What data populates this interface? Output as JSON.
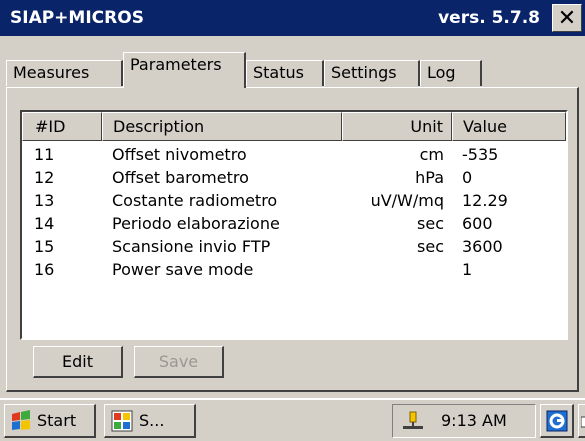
{
  "window": {
    "title": "SIAP+MICROS",
    "version": "vers. 5.7.8",
    "close_label": "✕"
  },
  "tabs": [
    {
      "label": "Measures",
      "active": false
    },
    {
      "label": "Parameters",
      "active": true
    },
    {
      "label": "Status",
      "active": false
    },
    {
      "label": "Settings",
      "active": false
    },
    {
      "label": "Log",
      "active": false
    }
  ],
  "table": {
    "columns": [
      "#ID",
      "Description",
      "Unit",
      "Value"
    ],
    "rows": [
      [
        "11",
        "Offset nivometro",
        "cm",
        "-535"
      ],
      [
        "12",
        "Offset barometro",
        "hPa",
        "0"
      ],
      [
        "13",
        "Costante radiometro",
        "uV/W/mq",
        "12.29"
      ],
      [
        "14",
        "Periodo elaborazione",
        "sec",
        "600"
      ],
      [
        "15",
        "Scansione invio FTP",
        "sec",
        "3600"
      ],
      [
        "16",
        "Power save mode",
        "",
        "1"
      ]
    ]
  },
  "buttons": {
    "edit": "Edit",
    "save": "Save"
  },
  "taskbar": {
    "start": "Start",
    "app": "S...",
    "time": "9:13 AM"
  },
  "colors": {
    "titlebar": "#0a246a",
    "face": "#d4d0c8"
  },
  "icons": {
    "start": "windows-flag-icon",
    "app": "app-window-icon",
    "network": "network-icon",
    "tray_app": "tray-app-icon",
    "keyboard": "keyboard-icon"
  }
}
